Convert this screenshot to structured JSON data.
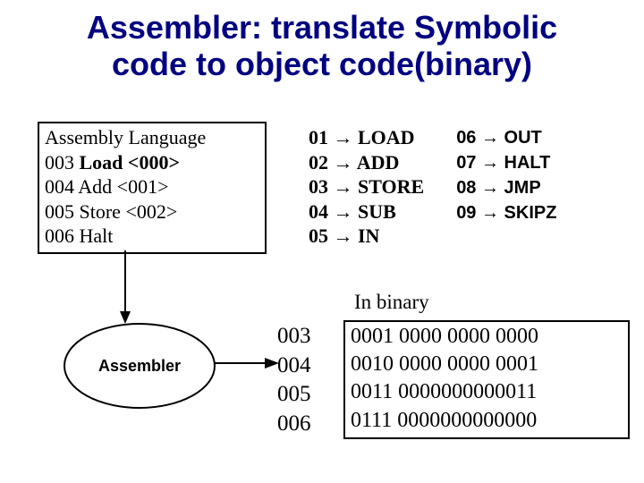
{
  "title_line1": "Assembler: translate Symbolic",
  "title_line2": "code to object code(binary)",
  "asm": {
    "header": "Assembly Language",
    "line1_addr": "003 ",
    "line1_instr": "Load <000>",
    "line2": "004 Add  <001>",
    "line3": "005 Store <002>",
    "line4": "006 Halt"
  },
  "opcodes_col1": {
    "o1": "01 → LOAD",
    "o2": "02 → ADD",
    "o3": "03 → STORE",
    "o4": "04 → SUB",
    "o5": "05 → IN"
  },
  "opcodes_col2": {
    "o6": "06 → OUT",
    "o7": "07 → HALT",
    "o8": "08 → JMP",
    "o9": "09 → SKIPZ"
  },
  "in_binary_label": "In binary",
  "addresses": {
    "a1": "003",
    "a2": "004",
    "a3": "005",
    "a4": "006"
  },
  "binary": {
    "b1": "0001  0000 0000 0000",
    "b2": "0010  0000 0000 0001",
    "b3": "0011  0000000000011",
    "b4": "0111  0000000000000"
  },
  "assembler_label": "Assembler",
  "chart_data": {
    "type": "table",
    "title": "Assembler symbolic-to-binary mapping",
    "opcode_table": [
      {
        "code": "01",
        "mnemonic": "LOAD"
      },
      {
        "code": "02",
        "mnemonic": "ADD"
      },
      {
        "code": "03",
        "mnemonic": "STORE"
      },
      {
        "code": "04",
        "mnemonic": "SUB"
      },
      {
        "code": "05",
        "mnemonic": "IN"
      },
      {
        "code": "06",
        "mnemonic": "OUT"
      },
      {
        "code": "07",
        "mnemonic": "HALT"
      },
      {
        "code": "08",
        "mnemonic": "JMP"
      },
      {
        "code": "09",
        "mnemonic": "SKIPZ"
      }
    ],
    "assembly_program": [
      {
        "address": "003",
        "instruction": "Load <000>"
      },
      {
        "address": "004",
        "instruction": "Add <001>"
      },
      {
        "address": "005",
        "instruction": "Store <002>"
      },
      {
        "address": "006",
        "instruction": "Halt"
      }
    ],
    "object_code": [
      {
        "address": "003",
        "binary": "0001 0000 0000 0000"
      },
      {
        "address": "004",
        "binary": "0010 0000 0000 0001"
      },
      {
        "address": "005",
        "binary": "0011 0000000000011"
      },
      {
        "address": "006",
        "binary": "0111 0000000000000"
      }
    ]
  }
}
